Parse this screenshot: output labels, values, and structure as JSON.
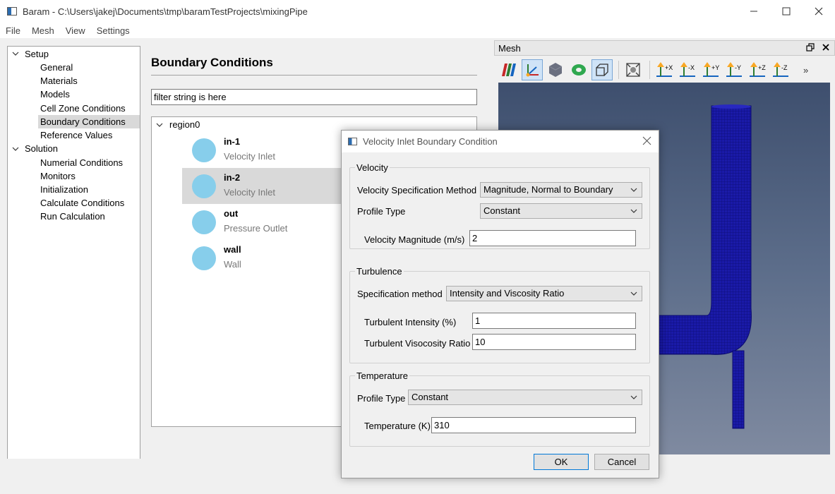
{
  "window": {
    "title": "Baram - C:\\Users\\jakej\\Documents\\tmp\\baramTestProjects\\mixingPipe"
  },
  "menu": {
    "items": [
      "File",
      "Mesh",
      "View",
      "Settings"
    ]
  },
  "tree": {
    "setup_label": "Setup",
    "setup_items": [
      "General",
      "Materials",
      "Models",
      "Cell Zone Conditions",
      "Boundary Conditions",
      "Reference Values"
    ],
    "selected": "Boundary Conditions",
    "solution_label": "Solution",
    "solution_items": [
      "Numerial Conditions",
      "Monitors",
      "Initialization",
      "Calculate Conditions",
      "Run Calculation"
    ]
  },
  "boundary_conditions": {
    "title": "Boundary Conditions",
    "filter_value": "filter string is here",
    "region": "region0",
    "items": [
      {
        "name": "in-1",
        "type": "Velocity Inlet"
      },
      {
        "name": "in-2",
        "type": "Velocity Inlet"
      },
      {
        "name": "out",
        "type": "Pressure Outlet"
      },
      {
        "name": "wall",
        "type": "Wall"
      }
    ],
    "selected_index": 1,
    "dot_color": "#87ceeb"
  },
  "mesh_panel": {
    "title": "Mesh",
    "axis_buttons": [
      "+X",
      "-X",
      "+Y",
      "-Y",
      "+Z",
      "-Z"
    ],
    "more_label": "»",
    "mesh_color": "#1a1aa8"
  },
  "dialog": {
    "title": "Velocity Inlet Boundary Condition",
    "velocity": {
      "group_label": "Velocity",
      "spec_method_label": "Velocity Specification Method",
      "spec_method_value": "Magnitude, Normal to Boundary",
      "profile_type_label": "Profile Type",
      "profile_type_value": "Constant",
      "magnitude_label": "Velocity Magnitude (m/s)",
      "magnitude_value": "2"
    },
    "turbulence": {
      "group_label": "Turbulence",
      "spec_method_label": "Specification method",
      "spec_method_value": "Intensity and Viscosity Ratio",
      "intensity_label": "Turbulent Intensity (%)",
      "intensity_value": "1",
      "viscosity_ratio_label": "Turbulent Visocosity Ratio",
      "viscosity_ratio_value": "10"
    },
    "temperature": {
      "group_label": "Temperature",
      "profile_type_label": "Profile Type",
      "profile_type_value": "Constant",
      "temperature_label": "Temperature (K)",
      "temperature_value": "310"
    },
    "ok_label": "OK",
    "cancel_label": "Cancel"
  }
}
